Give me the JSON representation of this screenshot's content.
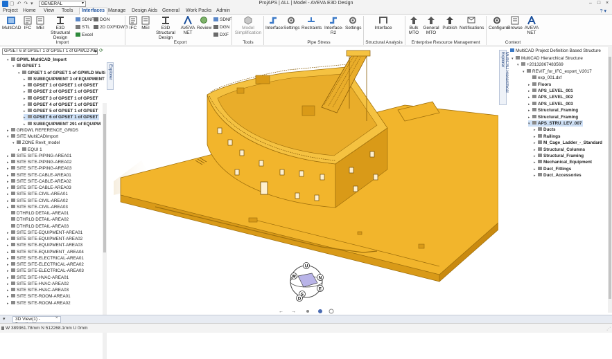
{
  "window": {
    "title": "ProjAPS | ALL | Model - AVEVA E3D Design",
    "quick_access_value": "GENERAL",
    "controls": [
      "–",
      "□",
      "×"
    ]
  },
  "menu": {
    "tabs": [
      "Project",
      "Home",
      "View",
      "Tools",
      "Interfaces",
      "Manage",
      "Design Aids",
      "General",
      "Work Packs",
      "Admin"
    ],
    "active": "Interfaces"
  },
  "ribbon": {
    "import": {
      "label": "Import",
      "buttons": [
        "MultiCAD",
        "IFC",
        "MEI",
        "E3D Structural Design"
      ],
      "small": [
        "SDNF",
        "STL",
        "Excel",
        "DGN",
        "2D DXF/DWG"
      ]
    },
    "export": {
      "label": "Export",
      "buttons": [
        "IFC",
        "MEI",
        "E3D Structural Design",
        "AVEVA NET",
        "Review"
      ],
      "small": [
        "SDNF",
        "DGN",
        "DXF"
      ]
    },
    "tools": {
      "label": "Tools",
      "buttons": [
        "Model Simplification"
      ]
    },
    "pipe_stress": {
      "label": "Pipe Stress",
      "buttons": [
        "Interface",
        "Settings",
        "Restraints",
        "Interface-R2",
        "Settings"
      ]
    },
    "structural": {
      "label": "Structural Analysis",
      "buttons": [
        "Interface"
      ]
    },
    "erm": {
      "label": "Enterprise Resource Management",
      "buttons": [
        "Bulk MTO",
        "General MTO",
        "Publish",
        "Notifications"
      ]
    },
    "context": {
      "label": "Context",
      "buttons": [
        "Configure",
        "Browse",
        "AVEVA NET"
      ]
    }
  },
  "left_panel": {
    "combo_value": "GPSET 6 of GPSET 1 of GPSET 1 of GPWLD /MultiCAD_",
    "tab_label": "Model Explorer",
    "rows": [
      {
        "text": "GPWL MultiCAD_Import",
        "level": 1,
        "exp": "▾",
        "bold": true
      },
      {
        "text": "GPSET 1",
        "level": 2,
        "exp": "▾",
        "bold": true
      },
      {
        "text": "GPSET 1 of GPSET 1 of GPWLD Multi",
        "level": 3,
        "exp": "▾",
        "bold": true
      },
      {
        "text": "SUBEQUIPMENT 3 of EQUIPMENT",
        "level": 4,
        "exp": "▸",
        "bold": true
      },
      {
        "text": "GPSET 1 of GPSET 1 of GPSET",
        "level": 4,
        "exp": "▸",
        "bold": true
      },
      {
        "text": "GPSET 2 of GPSET 1 of GPSET",
        "level": 4,
        "exp": "▸",
        "bold": true
      },
      {
        "text": "GPSET 3 of GPSET 1 of GPSET",
        "level": 4,
        "exp": "▸",
        "bold": true
      },
      {
        "text": "GPSET 4 of GPSET 1 of GPSET",
        "level": 4,
        "exp": "▸",
        "bold": true
      },
      {
        "text": "GPSET 5 of GPSET 1 of GPSET",
        "level": 4,
        "exp": "▸",
        "bold": true
      },
      {
        "text": "GPSET 6 of GPSET 1 of GPSET",
        "level": 4,
        "exp": "▸",
        "bold": true,
        "selected": true
      },
      {
        "text": "SUBEQUIPMENT 291 of EQUIPM",
        "level": 4,
        "exp": "▸",
        "bold": true
      },
      {
        "text": "GRIDWL REFERENCE_GRIDS",
        "level": 1,
        "exp": "▸"
      },
      {
        "text": "SITE MultiCADImport",
        "level": 1,
        "exp": "▾"
      },
      {
        "text": "ZONE Revit_model",
        "level": 2,
        "exp": "▾"
      },
      {
        "text": "EQUI 1",
        "level": 3,
        "exp": "▸"
      },
      {
        "text": "SITE SITE-PIPING-AREA01",
        "level": 1,
        "exp": "▸"
      },
      {
        "text": "SITE SITE-PIPING-AREA02",
        "level": 1,
        "exp": "▸"
      },
      {
        "text": "SITE SITE-PIPING-AREA03",
        "level": 1,
        "exp": "▸"
      },
      {
        "text": "SITE SITE-CABLE-AREA01",
        "level": 1,
        "exp": "▸"
      },
      {
        "text": "SITE SITE-CABLE-AREA02",
        "level": 1,
        "exp": "▸"
      },
      {
        "text": "SITE SITE-CABLE-AREA03",
        "level": 1,
        "exp": "▸"
      },
      {
        "text": "SITE SITE-CIVIL-AREA01",
        "level": 1,
        "exp": "▸"
      },
      {
        "text": "SITE SITE-CIVIL-AREA02",
        "level": 1,
        "exp": "▸"
      },
      {
        "text": "SITE SITE-CIVIL-AREA03",
        "level": 1,
        "exp": "▸"
      },
      {
        "text": "DTHRLD DETAIL-AREA01",
        "level": 1,
        "exp": ""
      },
      {
        "text": "DTHRLD DETAIL-AREA02",
        "level": 1,
        "exp": ""
      },
      {
        "text": "DTHRLD DETAIL-AREA03",
        "level": 1,
        "exp": ""
      },
      {
        "text": "SITE SITE-EQUIPMENT-AREA01",
        "level": 1,
        "exp": "▸"
      },
      {
        "text": "SITE SITE-EQUIPMENT-AREA02",
        "level": 1,
        "exp": "▸"
      },
      {
        "text": "SITE SITE-EQUIPMENT-AREA03",
        "level": 1,
        "exp": "▸"
      },
      {
        "text": "SITE SITE-EQUIPMENT_AREA04",
        "level": 1,
        "exp": "▸"
      },
      {
        "text": "SITE SITE-ELECTRICAL-AREA01",
        "level": 1,
        "exp": "▸"
      },
      {
        "text": "SITE SITE-ELECTRICAL-AREA02",
        "level": 1,
        "exp": "▸"
      },
      {
        "text": "SITE SITE-ELECTRICAL-AREA03",
        "level": 1,
        "exp": "▸"
      },
      {
        "text": "SITE SITE-HVAC-AREA01",
        "level": 1,
        "exp": "▸"
      },
      {
        "text": "SITE SITE-HVAC-AREA02",
        "level": 1,
        "exp": "▸"
      },
      {
        "text": "SITE SITE-HVAC-AREA03",
        "level": 1,
        "exp": "▸"
      },
      {
        "text": "SITE SITE-ROOM-AREA01",
        "level": 1,
        "exp": "▸"
      },
      {
        "text": "SITE SITE-ROOM-AREA02",
        "level": 1,
        "exp": "▸"
      }
    ]
  },
  "right_panel": {
    "header": "MultiCAD Project Definition Based Structure",
    "tab_label": "MultiCAD Hierarchical Explorer",
    "rows": [
      {
        "text": "MultiCAD Hierarchical Structure",
        "level": 0,
        "exp": "▾"
      },
      {
        "text": "+20132867483569",
        "level": 1,
        "exp": "▾"
      },
      {
        "text": "REVIT_for_IFC_export_V2017",
        "level": 2,
        "exp": "▾"
      },
      {
        "text": "exp_001.dxf",
        "level": 3,
        "exp": ""
      },
      {
        "text": "Floors",
        "level": 3,
        "exp": "▸",
        "bold": true
      },
      {
        "text": "APS_LEVEL_001",
        "level": 3,
        "exp": "▸",
        "bold": true
      },
      {
        "text": "APS_LEVEL_002",
        "level": 3,
        "exp": "▸",
        "bold": true
      },
      {
        "text": "APS_LEVEL_003",
        "level": 3,
        "exp": "▸",
        "bold": true
      },
      {
        "text": "Structural_Framing",
        "level": 3,
        "exp": "▸",
        "bold": true
      },
      {
        "text": "Structural_Framing",
        "level": 3,
        "exp": "▸",
        "bold": true
      },
      {
        "text": "APS_STRU_LEV_007",
        "level": 3,
        "exp": "▾",
        "bold": true,
        "selected": true
      },
      {
        "text": "Ducts",
        "level": 4,
        "exp": "▸",
        "bold": true
      },
      {
        "text": "Railings",
        "level": 4,
        "exp": "▸",
        "bold": true
      },
      {
        "text": "M_Cage_Ladder_-_Standard",
        "level": 4,
        "exp": "▸",
        "bold": true
      },
      {
        "text": "Structural_Columns",
        "level": 4,
        "exp": "▸",
        "bold": true
      },
      {
        "text": "Structural_Framing",
        "level": 4,
        "exp": "▸",
        "bold": true
      },
      {
        "text": "Mechanical_Equipment",
        "level": 4,
        "exp": "▸",
        "bold": true
      },
      {
        "text": "Duct_Fittings",
        "level": 4,
        "exp": "▸",
        "bold": true
      },
      {
        "text": "Duct_Accessories",
        "level": 4,
        "exp": "▸",
        "bold": true
      }
    ]
  },
  "viewport": {
    "model_color": "#f2b52c",
    "model_shade": "#d99a18",
    "model_edge": "#a0700c",
    "navcube_letters": [
      "U",
      "W",
      "N",
      "E",
      "S",
      "D"
    ]
  },
  "bottom": {
    "doc_tab": "3D View(1) - Drawlist(1)",
    "status": "W 389361.78mm N 512268.1mm U 0mm"
  },
  "colors": {
    "accent": "#1a4f9c",
    "selection": "#cfe1f7"
  }
}
